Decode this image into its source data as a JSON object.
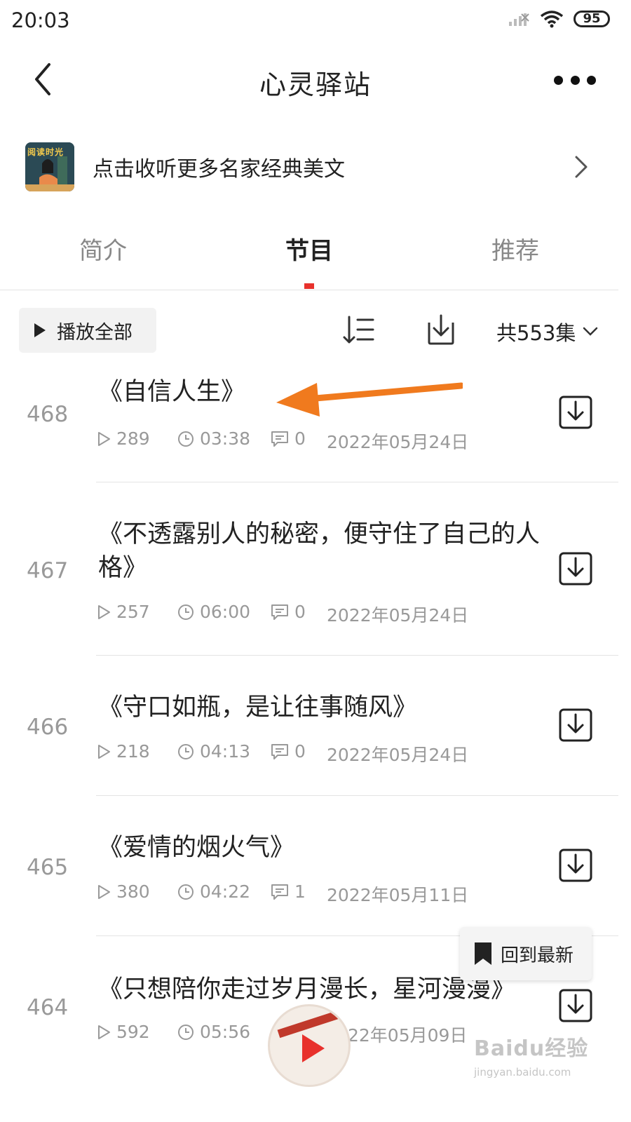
{
  "status_bar": {
    "time": "20:03",
    "battery": "95"
  },
  "header": {
    "title": "心灵驿站"
  },
  "promo": {
    "text": "点击收听更多名家经典美文",
    "cover_text": "阅读时光"
  },
  "tabs": [
    {
      "label": "简介"
    },
    {
      "label": "节目"
    },
    {
      "label": "推荐"
    }
  ],
  "toolbar": {
    "play_all_label": "播放全部",
    "count_label": "共553集"
  },
  "episodes": [
    {
      "number": "468",
      "title": "《自信人生》",
      "plays": "289",
      "duration": "03:38",
      "comments": "0",
      "date": "2022年05月24日"
    },
    {
      "number": "467",
      "title": "《不透露别人的秘密，便守住了自己的人格》",
      "plays": "257",
      "duration": "06:00",
      "comments": "0",
      "date": "2022年05月24日"
    },
    {
      "number": "466",
      "title": "《守口如瓶，是让往事随风》",
      "plays": "218",
      "duration": "04:13",
      "comments": "0",
      "date": "2022年05月24日"
    },
    {
      "number": "465",
      "title": "《爱情的烟火气》",
      "plays": "380",
      "duration": "04:22",
      "comments": "1",
      "date": "2022年05月11日"
    },
    {
      "number": "464",
      "title": "《只想陪你走过岁月漫长，星河漫漫》",
      "plays": "592",
      "duration": "05:56",
      "comments": "",
      "date": "22年05月09日"
    }
  ],
  "back_to_latest": {
    "label": "回到最新"
  },
  "watermark": {
    "main": "Baidu经验",
    "sub": "jingyan.baidu.com"
  },
  "colors": {
    "accent": "#e8312c",
    "annotation": "#f07a1e",
    "muted": "#999999"
  },
  "icons": [
    "back-icon",
    "more-icon",
    "chevron-right-icon",
    "play-icon",
    "sort-icon",
    "download-icon",
    "chevron-down-icon",
    "clock-icon",
    "comment-icon",
    "bookmark-icon"
  ]
}
